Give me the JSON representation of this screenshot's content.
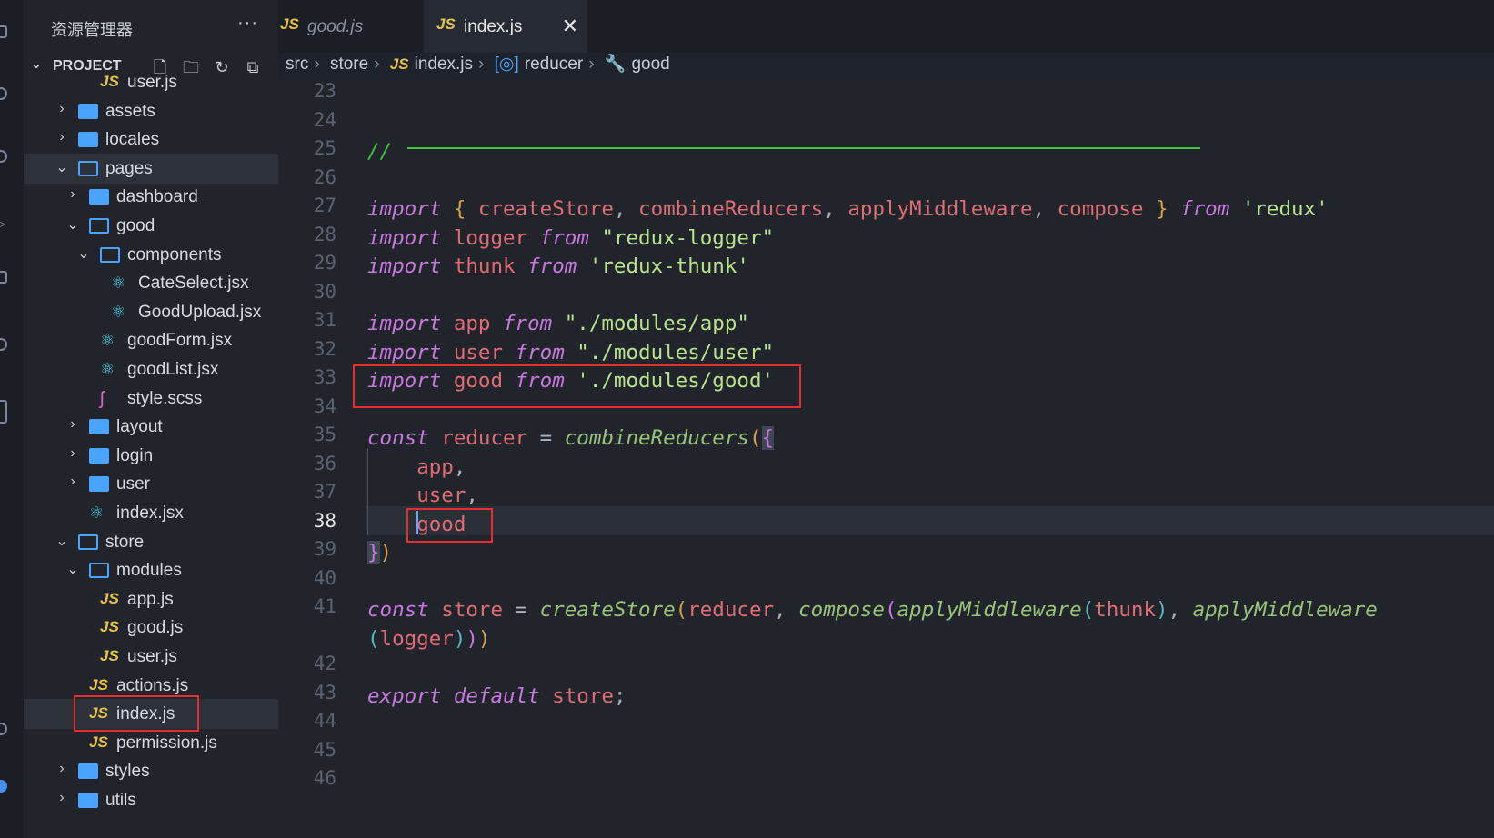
{
  "sidebar": {
    "title": "资源管理器",
    "more": "···",
    "section": "PROJECT",
    "tree": [
      {
        "name": "user.js",
        "type": "js",
        "depth": 3,
        "chev": ""
      },
      {
        "name": "assets",
        "type": "folder",
        "depth": 1,
        "chev": "›"
      },
      {
        "name": "locales",
        "type": "folder",
        "depth": 1,
        "chev": "›"
      },
      {
        "name": "pages",
        "type": "folder-open",
        "depth": 1,
        "chev": "⌄"
      },
      {
        "name": "dashboard",
        "type": "folder",
        "depth": 2,
        "chev": "›"
      },
      {
        "name": "good",
        "type": "folder-open",
        "depth": 2,
        "chev": "⌄"
      },
      {
        "name": "components",
        "type": "folder-open",
        "depth": 3,
        "chev": "⌄"
      },
      {
        "name": "CateSelect.jsx",
        "type": "react",
        "depth": 4,
        "chev": ""
      },
      {
        "name": "GoodUpload.jsx",
        "type": "react",
        "depth": 4,
        "chev": ""
      },
      {
        "name": "goodForm.jsx",
        "type": "react",
        "depth": 3,
        "chev": ""
      },
      {
        "name": "goodList.jsx",
        "type": "react",
        "depth": 3,
        "chev": ""
      },
      {
        "name": "style.scss",
        "type": "sass",
        "depth": 3,
        "chev": ""
      },
      {
        "name": "layout",
        "type": "folder",
        "depth": 2,
        "chev": "›"
      },
      {
        "name": "login",
        "type": "folder",
        "depth": 2,
        "chev": "›"
      },
      {
        "name": "user",
        "type": "folder",
        "depth": 2,
        "chev": "›"
      },
      {
        "name": "index.jsx",
        "type": "react",
        "depth": 2,
        "chev": ""
      },
      {
        "name": "store",
        "type": "folder-open",
        "depth": 1,
        "chev": "⌄"
      },
      {
        "name": "modules",
        "type": "folder-open",
        "depth": 2,
        "chev": "⌄"
      },
      {
        "name": "app.js",
        "type": "js",
        "depth": 3,
        "chev": ""
      },
      {
        "name": "good.js",
        "type": "js",
        "depth": 3,
        "chev": ""
      },
      {
        "name": "user.js",
        "type": "js",
        "depth": 3,
        "chev": ""
      },
      {
        "name": "actions.js",
        "type": "js",
        "depth": 2,
        "chev": ""
      },
      {
        "name": "index.js",
        "type": "js",
        "depth": 2,
        "chev": "",
        "selected": true
      },
      {
        "name": "permission.js",
        "type": "js",
        "depth": 2,
        "chev": ""
      },
      {
        "name": "styles",
        "type": "folder",
        "depth": 1,
        "chev": "›"
      },
      {
        "name": "utils",
        "type": "folder",
        "depth": 1,
        "chev": "›"
      }
    ]
  },
  "tabs": {
    "inactive": {
      "icon": "JS",
      "name": "good.js"
    },
    "active": {
      "icon": "JS",
      "name": "index.js",
      "close": "✕"
    }
  },
  "breadcrumbs": {
    "src": "src",
    "store": "store",
    "icon": "JS",
    "file": "index.js",
    "reducer": "reducer",
    "good": "good",
    "sep": "›"
  },
  "editor": {
    "line_numbers": [
      "23",
      "24",
      "25",
      "26",
      "27",
      "28",
      "29",
      "30",
      "31",
      "32",
      "33",
      "34",
      "35",
      "36",
      "37",
      "38",
      "39",
      "40",
      "41",
      "",
      "42",
      "43",
      "44",
      "45",
      "46"
    ],
    "current_line": "38",
    "code": [
      {
        "ln": "25",
        "t": [
          [
            "cm",
            "//"
          ]
        ]
      },
      {
        "ln": "27",
        "t": [
          [
            "kw",
            "import"
          ],
          [
            "pun",
            " "
          ],
          [
            "br1",
            "{"
          ],
          [
            "pun",
            " "
          ],
          [
            "id",
            "createStore"
          ],
          [
            "pun",
            ", "
          ],
          [
            "id",
            "combineReducers"
          ],
          [
            "pun",
            ", "
          ],
          [
            "id",
            "applyMiddleware"
          ],
          [
            "pun",
            ", "
          ],
          [
            "id",
            "compose"
          ],
          [
            "pun",
            " "
          ],
          [
            "br1",
            "}"
          ],
          [
            "pun",
            " "
          ],
          [
            "kw",
            "from"
          ],
          [
            "pun",
            " "
          ],
          [
            "str",
            "'redux'"
          ]
        ]
      },
      {
        "ln": "28",
        "t": [
          [
            "kw",
            "import"
          ],
          [
            "pun",
            " "
          ],
          [
            "id",
            "logger"
          ],
          [
            "pun",
            " "
          ],
          [
            "kw",
            "from"
          ],
          [
            "pun",
            " "
          ],
          [
            "str",
            "\"redux-logger\""
          ]
        ]
      },
      {
        "ln": "29",
        "t": [
          [
            "kw",
            "import"
          ],
          [
            "pun",
            " "
          ],
          [
            "id",
            "thunk"
          ],
          [
            "pun",
            " "
          ],
          [
            "kw",
            "from"
          ],
          [
            "pun",
            " "
          ],
          [
            "str",
            "'redux-thunk'"
          ]
        ]
      },
      {
        "ln": "31",
        "t": [
          [
            "kw",
            "import"
          ],
          [
            "pun",
            " "
          ],
          [
            "id",
            "app"
          ],
          [
            "pun",
            " "
          ],
          [
            "kw",
            "from"
          ],
          [
            "pun",
            " "
          ],
          [
            "str",
            "\"./modules/app\""
          ]
        ]
      },
      {
        "ln": "32",
        "t": [
          [
            "kw",
            "import"
          ],
          [
            "pun",
            " "
          ],
          [
            "id",
            "user"
          ],
          [
            "pun",
            " "
          ],
          [
            "kw",
            "from"
          ],
          [
            "pun",
            " "
          ],
          [
            "str",
            "\"./modules/user\""
          ]
        ]
      },
      {
        "ln": "33",
        "t": [
          [
            "kw",
            "import"
          ],
          [
            "pun",
            " "
          ],
          [
            "id",
            "good"
          ],
          [
            "pun",
            " "
          ],
          [
            "kw",
            "from"
          ],
          [
            "pun",
            " "
          ],
          [
            "str",
            "'./modules/good'"
          ]
        ]
      },
      {
        "ln": "35",
        "t": [
          [
            "kw",
            "const"
          ],
          [
            "pun",
            " "
          ],
          [
            "id",
            "reducer"
          ],
          [
            "pun",
            " = "
          ],
          [
            "fn",
            "combineReducers"
          ],
          [
            "br1",
            "("
          ],
          [
            "br2",
            "{"
          ]
        ]
      },
      {
        "ln": "36",
        "t": [
          [
            "pun",
            "    "
          ],
          [
            "id",
            "app"
          ],
          [
            "pun",
            ","
          ]
        ]
      },
      {
        "ln": "37",
        "t": [
          [
            "pun",
            "    "
          ],
          [
            "id",
            "user"
          ],
          [
            "pun",
            ","
          ]
        ]
      },
      {
        "ln": "38",
        "t": [
          [
            "pun",
            "    "
          ],
          [
            "id",
            "good"
          ]
        ]
      },
      {
        "ln": "39",
        "t": [
          [
            "br2",
            "}"
          ],
          [
            "br1",
            ")"
          ]
        ]
      },
      {
        "ln": "41",
        "t": [
          [
            "kw",
            "const"
          ],
          [
            "pun",
            " "
          ],
          [
            "id",
            "store"
          ],
          [
            "pun",
            " = "
          ],
          [
            "fn",
            "createStore"
          ],
          [
            "br1",
            "("
          ],
          [
            "id",
            "reducer"
          ],
          [
            "pun",
            ", "
          ],
          [
            "fn",
            "compose"
          ],
          [
            "br2",
            "("
          ],
          [
            "fn",
            "applyMiddleware"
          ],
          [
            "br3",
            "("
          ],
          [
            "id",
            "thunk"
          ],
          [
            "br3",
            ")"
          ],
          [
            "pun",
            ", "
          ],
          [
            "fn",
            "applyMiddleware"
          ]
        ]
      },
      {
        "ln": "41b",
        "t": [
          [
            "br3",
            "("
          ],
          [
            "id",
            "logger"
          ],
          [
            "br3",
            ")"
          ],
          [
            "br2",
            ")"
          ],
          [
            "br1",
            ")"
          ]
        ]
      },
      {
        "ln": "43",
        "t": [
          [
            "kw",
            "export"
          ],
          [
            "pun",
            " "
          ],
          [
            "kw",
            "default"
          ],
          [
            "pun",
            " "
          ],
          [
            "id",
            "store"
          ],
          [
            "pun",
            ";"
          ]
        ]
      }
    ]
  },
  "colors": {
    "highlight_box": "#e52f2f",
    "comment": "#3cc43c",
    "keyword": "#c678dd",
    "identifier": "#e06c75",
    "string": "#b9e28c",
    "function": "#98c379"
  }
}
